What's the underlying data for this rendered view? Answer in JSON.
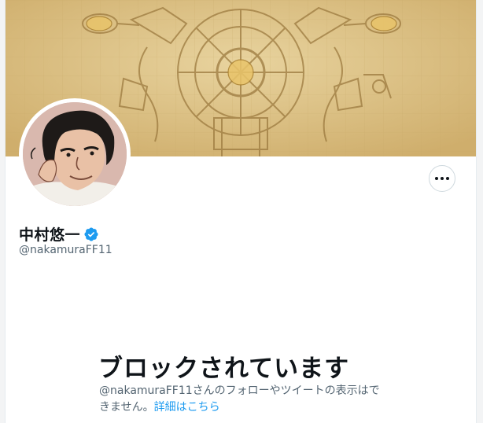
{
  "profile": {
    "display_name": "中村悠一",
    "handle": "@nakamuraFF11",
    "verified": true
  },
  "icons": {
    "more": "more-options-icon",
    "verified": "verified-badge-icon"
  },
  "blocked": {
    "title": "ブロックされています",
    "description": "@nakamuraFF11さんのフォローやツイートの表示はできません。",
    "learn_more": "詳細はこちら"
  },
  "colors": {
    "link": "#1d9bf0",
    "verified": "#1d9bf0",
    "banner": "#dcc489"
  }
}
